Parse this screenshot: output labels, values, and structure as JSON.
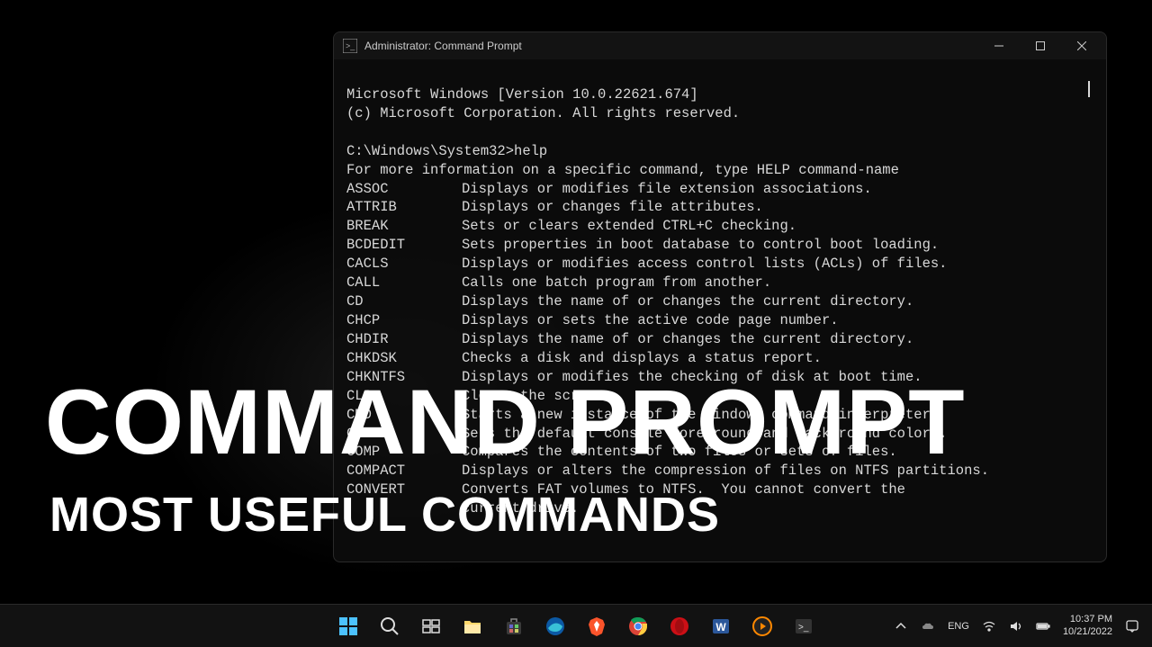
{
  "window": {
    "title": "Administrator: Command Prompt"
  },
  "terminal": {
    "line1": "Microsoft Windows [Version 10.0.22621.674]",
    "line2": "(c) Microsoft Corporation. All rights reserved.",
    "prompt": "C:\\Windows\\System32>",
    "command": "help",
    "help_intro": "For more information on a specific command, type HELP command-name",
    "commands": [
      {
        "name": "ASSOC",
        "desc": "Displays or modifies file extension associations."
      },
      {
        "name": "ATTRIB",
        "desc": "Displays or changes file attributes."
      },
      {
        "name": "BREAK",
        "desc": "Sets or clears extended CTRL+C checking."
      },
      {
        "name": "BCDEDIT",
        "desc": "Sets properties in boot database to control boot loading."
      },
      {
        "name": "CACLS",
        "desc": "Displays or modifies access control lists (ACLs) of files."
      },
      {
        "name": "CALL",
        "desc": "Calls one batch program from another."
      },
      {
        "name": "CD",
        "desc": "Displays the name of or changes the current directory."
      },
      {
        "name": "CHCP",
        "desc": "Displays or sets the active code page number."
      },
      {
        "name": "CHDIR",
        "desc": "Displays the name of or changes the current directory."
      },
      {
        "name": "CHKDSK",
        "desc": "Checks a disk and displays a status report."
      },
      {
        "name": "CHKNTFS",
        "desc": "Displays or modifies the checking of disk at boot time."
      },
      {
        "name": "CLS",
        "desc": "Clears the screen."
      },
      {
        "name": "CMD",
        "desc": "Starts a new instance of the Windows command interpreter."
      },
      {
        "name": "COLOR",
        "desc": "Sets the default console foreground and background colors."
      },
      {
        "name": "COMP",
        "desc": "Compares the contents of two files or sets of files."
      },
      {
        "name": "COMPACT",
        "desc": "Displays or alters the compression of files on NTFS partitions."
      },
      {
        "name": "CONVERT",
        "desc": "Converts FAT volumes to NTFS.  You cannot convert the"
      },
      {
        "name": "",
        "desc": "current drive."
      }
    ]
  },
  "overlay": {
    "main": "COMMAND PROMPT",
    "sub": "MOST USEFUL COMMANDS"
  },
  "taskbar": {
    "lang": "ENG",
    "time": "10:37 PM",
    "date": "10/21/2022"
  }
}
